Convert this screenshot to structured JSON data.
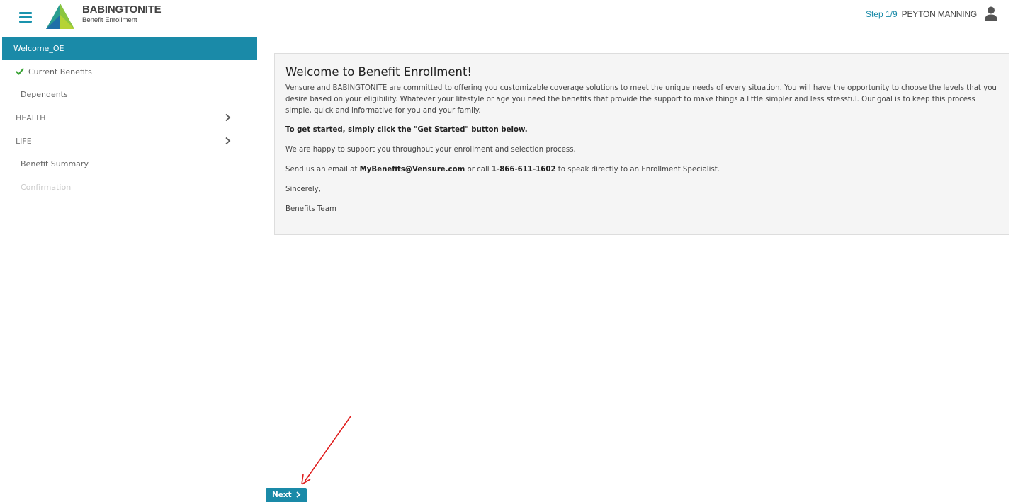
{
  "header": {
    "menu_icon": "hamburger-menu-icon",
    "logo_icon": "triangle-logo-icon",
    "brand_name": "BABINGTONITE",
    "brand_subtitle": "Benefit Enrollment",
    "step": "Step 1/9",
    "user_name": "PEYTON MANNING",
    "user_icon": "user-icon"
  },
  "sidebar": {
    "items": [
      {
        "label": "Welcome_OE",
        "state": "active"
      },
      {
        "label": "Current Benefits",
        "state": "completed",
        "icon": "checkmark-icon"
      },
      {
        "label": "Dependents",
        "state": "normal"
      },
      {
        "label": "HEALTH",
        "state": "section",
        "icon": "chevron-right-icon"
      },
      {
        "label": "LIFE",
        "state": "section",
        "icon": "chevron-right-icon"
      },
      {
        "label": "Benefit Summary",
        "state": "normal"
      },
      {
        "label": "Confirmation",
        "state": "disabled"
      }
    ]
  },
  "welcome": {
    "title": "Welcome to Benefit Enrollment!",
    "intro": "Vensure and BABINGTONITE are committed to offering you customizable coverage solutions to meet the unique needs of every situation. You will have the opportunity to choose the levels that you desire based on your eligibility. Whatever your lifestyle or age you need the benefits that provide the support to make things a little simpler and less stressful. Our goal is to keep this process simple, quick and informative for you and your family.",
    "get_started": "To get started, simply click the \"Get Started\" button below.",
    "support": "We are happy to support you throughout your enrollment and selection process.",
    "contact_prefix": "Send us an email at ",
    "contact_email": "MyBenefits@Vensure.com",
    "contact_middle": " or call ",
    "contact_phone": "1-866-611-1602",
    "contact_suffix": " to speak directly to an Enrollment Specialist.",
    "closing": "Sincerely,",
    "signature": "Benefits Team"
  },
  "footer": {
    "next_label": "Next",
    "next_icon": "chevron-right-icon"
  },
  "colors": {
    "accent": "#1a8aa8",
    "check": "#3aa335",
    "annotation": "#e02020"
  }
}
